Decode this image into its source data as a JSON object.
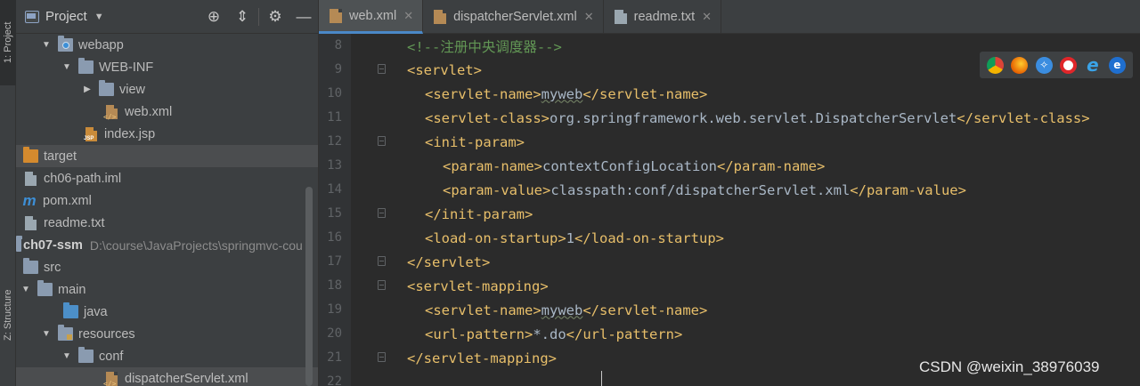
{
  "tool_windows": {
    "project_tab": "1: Project",
    "structure_tab": "Z: Structure"
  },
  "project_panel": {
    "title": "Project",
    "tree": [
      {
        "label": "webapp",
        "icon": "folder-web-icon"
      },
      {
        "label": "WEB-INF",
        "icon": "folder-icon"
      },
      {
        "label": "view",
        "icon": "folder-icon"
      },
      {
        "label": "web.xml",
        "icon": "xml-file-icon"
      },
      {
        "label": "index.jsp",
        "icon": "jsp-file-icon"
      },
      {
        "label": "target",
        "icon": "folder-orange-icon"
      },
      {
        "label": "ch06-path.iml",
        "icon": "iml-file-icon"
      },
      {
        "label": "pom.xml",
        "icon": "maven-icon"
      },
      {
        "label": "readme.txt",
        "icon": "text-file-icon"
      },
      {
        "label": "ch07-ssm",
        "path": "D:\\course\\JavaProjects\\springmvc-cou",
        "icon": "module-folder-icon"
      },
      {
        "label": "src",
        "icon": "folder-icon"
      },
      {
        "label": "main",
        "icon": "folder-icon"
      },
      {
        "label": "java",
        "icon": "source-folder-icon"
      },
      {
        "label": "resources",
        "icon": "resources-folder-icon"
      },
      {
        "label": "conf",
        "icon": "folder-icon"
      },
      {
        "label": "dispatcherServlet.xml",
        "icon": "xml-file-icon"
      }
    ]
  },
  "editor": {
    "tabs": [
      {
        "label": "web.xml",
        "active": true
      },
      {
        "label": "dispatcherServlet.xml",
        "active": false
      },
      {
        "label": "readme.txt",
        "active": false
      }
    ],
    "line_numbers": [
      "8",
      "9",
      "10",
      "11",
      "12",
      "13",
      "14",
      "15",
      "16",
      "17",
      "18",
      "19",
      "20",
      "21",
      "22"
    ],
    "lines": {
      "l8_comment": "<!--注册中央调度器-->",
      "servlet": "servlet",
      "servlet_name": "servlet-name",
      "servlet_name_value": "myweb",
      "servlet_class": "servlet-class",
      "servlet_class_value": "org.springframework.web.servlet.DispatcherServlet",
      "init_param": "init-param",
      "param_name": "param-name",
      "param_name_value": "contextConfigLocation",
      "param_value": "param-value",
      "param_value_value": "classpath:conf/dispatcherServlet.xml",
      "load_on_startup": "load-on-startup",
      "load_on_startup_value": "1",
      "servlet_mapping": "servlet-mapping",
      "url_pattern": "url-pattern",
      "url_pattern_value": "*.do"
    },
    "browsers": [
      "chrome-icon",
      "firefox-icon",
      "safari-icon",
      "opera-icon",
      "ie-icon",
      "edge-icon"
    ]
  },
  "watermark": "CSDN @weixin_38976039",
  "colors": {
    "tag": "#e8bf6a",
    "comment": "#629755",
    "text": "#a9b7c6",
    "accent": "#4a88c7"
  }
}
